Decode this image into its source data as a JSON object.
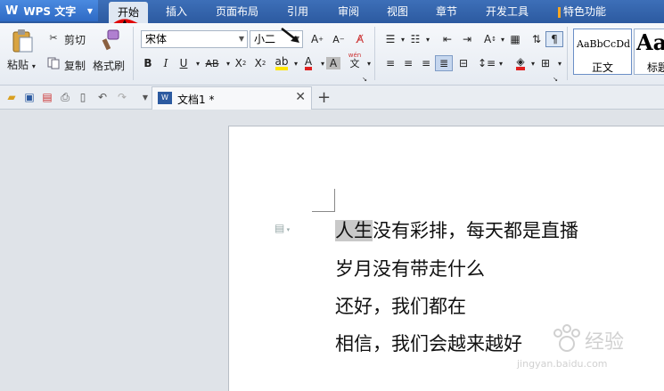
{
  "app": {
    "name": "WPS 文字"
  },
  "menu_tabs": [
    "开始",
    "插入",
    "页面布局",
    "引用",
    "审阅",
    "视图",
    "章节",
    "开发工具",
    "特色功能"
  ],
  "clipboard": {
    "paste": "粘贴",
    "cut": "剪切",
    "copy": "复制",
    "format_painter": "格式刷"
  },
  "font": {
    "name": "宋体",
    "size": "小二"
  },
  "styles": {
    "normal_preview": "AaBbCcDd",
    "normal_label": "正文",
    "heading_preview": "Aa",
    "heading_label": "标题"
  },
  "paragraph_extra": {
    "phonetic": "wén"
  },
  "document_tab": {
    "title": "文档1 *"
  },
  "document_lines": [
    {
      "selected": "人生",
      "rest": "没有彩排，每天都是直播"
    },
    {
      "text": "岁月没有带走什么"
    },
    {
      "text": "还好，我们都在"
    },
    {
      "text": "相信，我们会越来越好"
    }
  ],
  "watermark": {
    "brand": "经验",
    "url": "jingyan.baidu.com"
  },
  "colors": {
    "menubar": "#2c5aa0",
    "highlight_yellow": "#ffe600",
    "font_color_red": "#e02020",
    "annotation_red": "#e00000"
  }
}
